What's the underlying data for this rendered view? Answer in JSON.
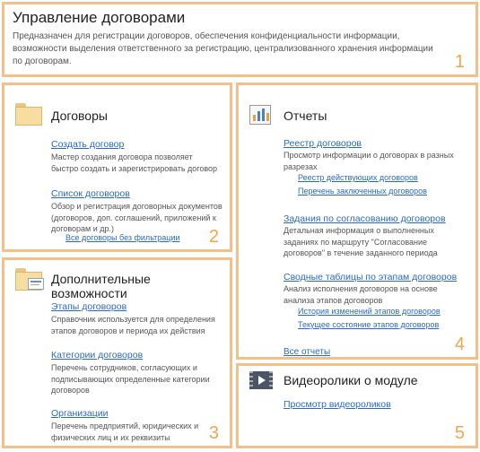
{
  "header": {
    "title": "Управление договорами",
    "description": "Предназначен для регистрации договоров, обеспечения конфиденциальности информации, возможности выделения ответственного за регистрацию, централизованного хранения информации по договорам.",
    "number": "1"
  },
  "contracts": {
    "title": "Договоры",
    "number": "2",
    "create_link": "Создать договор",
    "create_desc": "Мастер создания договора позволяет быстро создать и зарегистрировать договор",
    "list_link": "Список договоров",
    "list_desc": "Обзор и регистрация договорных документов (договоров, доп. соглашений, приложений к договорам и др.)",
    "all_link": "Все договоры без фильтрации"
  },
  "extra": {
    "title": "Дополнительные возможности",
    "number": "3",
    "stages_link": "Этапы договоров",
    "stages_desc": "Справочник используется для определения этапов договоров и периода их действия",
    "categories_link": "Категории договоров",
    "categories_desc": "Перечень сотрудников, согласующих и подписывающих определенные категории договоров",
    "orgs_link": "Организации",
    "orgs_desc": "Перечень предприятий, юридических и физических лиц и их реквизиты"
  },
  "reports": {
    "title": "Отчеты",
    "number": "4",
    "registry_link": "Реестр договоров",
    "registry_desc": "Просмотр информации о договорах в разных разрезах",
    "registry_sub1": "Реестр действующих договоров",
    "registry_sub2": "Перечень заключенных договоров",
    "tasks_link": "Задания по согласованию договоров",
    "tasks_desc": "Детальная информация о выполненных заданиях по маршруту \"Согласование договоров\" в течение заданного периода",
    "pivot_link": "Сводные таблицы по этапам договоров",
    "pivot_desc": "Анализ исполнения договоров на основе анализа этапов договоров",
    "pivot_sub1": "История изменений этапов договоров",
    "pivot_sub2": "Текущее состояние этапов договоров",
    "all_link": "Все отчеты"
  },
  "videos": {
    "title": "Видеоролики о модуле",
    "number": "5",
    "link": "Просмотр видеороликов"
  },
  "icons": {
    "folder": "folder-icon",
    "folder_doc": "folder-document-icon",
    "chart": "bar-chart-icon",
    "video": "video-icon"
  },
  "colors": {
    "border": "#f2c08a",
    "number": "#f0a64e",
    "link": "#2a6ac2"
  }
}
